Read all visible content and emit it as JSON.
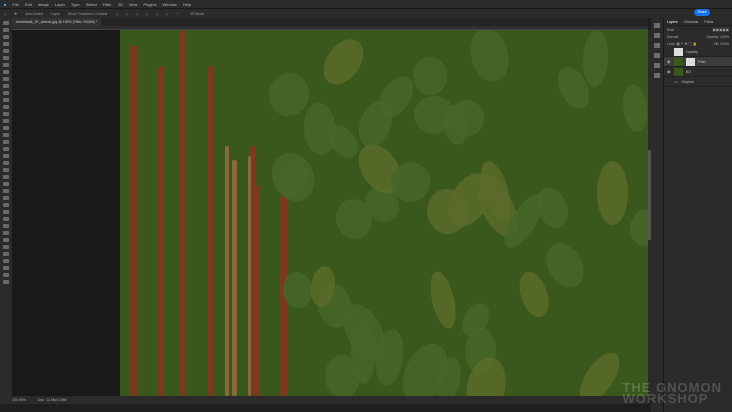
{
  "menu": [
    "File",
    "Edit",
    "Image",
    "Layer",
    "Type",
    "Select",
    "Filter",
    "3D",
    "View",
    "Plugins",
    "Window",
    "Help"
  ],
  "options": {
    "auto_select": "Auto-Select",
    "layer_select": "Layer",
    "transform": "Show Transform Controls",
    "mode_3d": "3D Mode"
  },
  "share_label": "Share",
  "document_tab": "wheatstalk_2K_Albedo.jpg @ 100% (Filter, RGB/8) *",
  "status": {
    "zoom": "100.00%",
    "doc": "Doc: 12.0M/2.39M"
  },
  "layers_panel": {
    "tabs": [
      "Layers",
      "Channels",
      "Paths"
    ],
    "filter": "Kind",
    "blend_mode": "Normal",
    "opacity_label": "Opacity:",
    "opacity": "100%",
    "lock_label": "Lock:",
    "fill_label": "Fill:",
    "fill": "100%",
    "layers": [
      {
        "name": "Opacity",
        "visible": false
      },
      {
        "name": "Filter",
        "visible": true,
        "selected": true
      },
      {
        "name": "BG",
        "visible": true
      },
      {
        "name": "Original",
        "visible": false,
        "group": true
      }
    ]
  },
  "watermark": "THE GNOMON WORKSHOP"
}
